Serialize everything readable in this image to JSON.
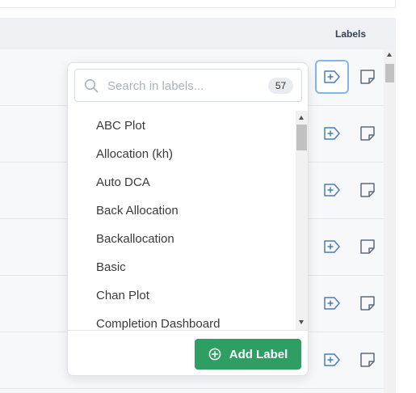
{
  "table": {
    "labels_header": "Labels",
    "row_count": 6
  },
  "popover": {
    "search": {
      "placeholder": "Search in labels...",
      "value": "",
      "count": "57"
    },
    "items": [
      "ABC Plot",
      "Allocation (kh)",
      "Auto DCA",
      "Back Allocation",
      "Backallocation",
      "Basic",
      "Chan Plot",
      "Completion Dashboard"
    ],
    "add_label_button": "Add Label"
  },
  "icons": {
    "row_label": "add-label-icon",
    "row_note": "note-icon",
    "search": "search-icon",
    "add": "plus-circle-icon"
  },
  "colors": {
    "accent_green": "#2e9e63",
    "active_border": "#82b6e8",
    "icon_blue": "#4a7db8",
    "icon_gray": "#5f6b7a"
  }
}
